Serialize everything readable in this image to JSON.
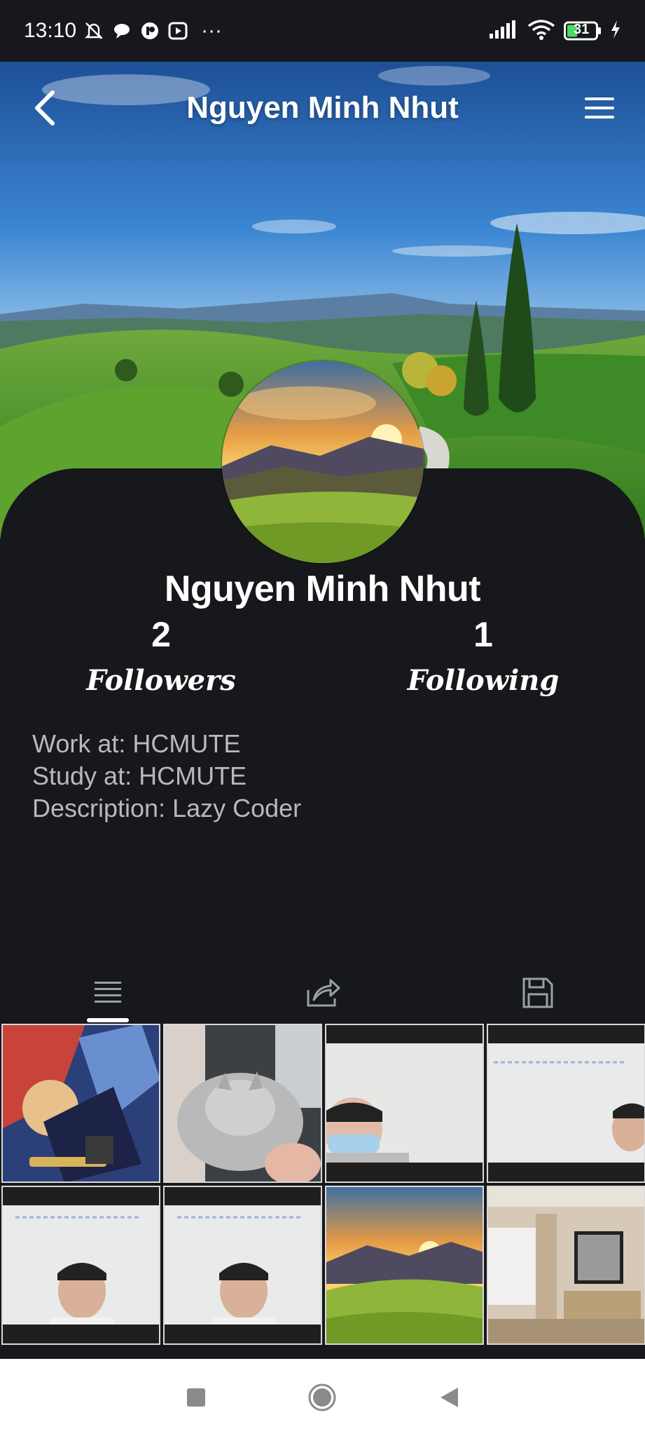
{
  "status_bar": {
    "time": "13:10",
    "more": "···",
    "battery": "31",
    "icons": [
      "bell-off-icon",
      "chat-bubble-icon",
      "app-badge-icon",
      "play-box-icon",
      "signal-icon",
      "wifi-icon",
      "battery-icon",
      "charging-icon"
    ]
  },
  "header": {
    "title": "Nguyen Minh Nhut",
    "back_icon": "chevron-left-icon",
    "menu_icon": "hamburger-icon"
  },
  "profile": {
    "name": "Nguyen Minh Nhut",
    "followers_count": "2",
    "followers_label": "Followers",
    "following_count": "1",
    "following_label": "Following",
    "work": "Work at: HCMUTE",
    "study": "Study at: HCMUTE",
    "description": "Description: Lazy Coder"
  },
  "tabs": [
    {
      "icon": "list-icon",
      "active": true
    },
    {
      "icon": "share-icon",
      "active": false
    },
    {
      "icon": "save-icon",
      "active": false
    }
  ],
  "grid_thumbs": [
    "game-poster",
    "cat-photo",
    "selfie-mask",
    "selfie-wall",
    "selfie-wall",
    "selfie-wall",
    "sunset-landscape",
    "room-interior"
  ],
  "colors": {
    "background": "#16181b",
    "text": "#ffffff",
    "info_text": "#b9b9b9",
    "system_nav": "#ffffff"
  },
  "system_nav": [
    "recents-square-icon",
    "home-circle-icon",
    "back-triangle-icon"
  ]
}
